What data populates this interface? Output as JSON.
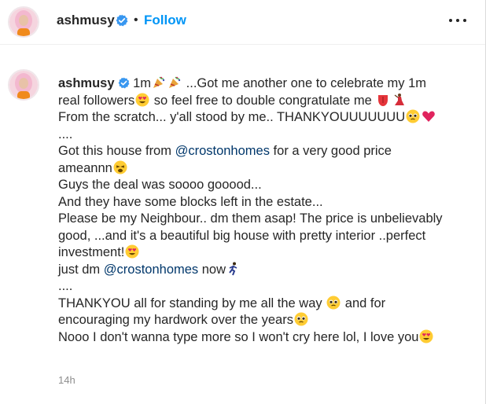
{
  "header": {
    "username": "ashmusy",
    "separator": "•",
    "follow_label": "Follow",
    "more_icon": "more-options-icon"
  },
  "caption": {
    "username": "ashmusy",
    "lines": [
      {
        "parts": [
          {
            "t": " 1m"
          },
          {
            "e": "party-popper"
          },
          {
            "e": "party-popper"
          },
          {
            "t": " ...Got me another one to celebrate my 1m"
          }
        ]
      },
      {
        "parts": [
          {
            "t": "real followers"
          },
          {
            "e": "heart-eyes"
          },
          {
            "t": " so feel free to double congratulate me "
          },
          {
            "e": "tongue"
          },
          {
            "e": "dancer"
          }
        ]
      },
      {
        "parts": [
          {
            "t": "From the scratch... y'all stood by me.. THANKYOUUUUUUU"
          },
          {
            "e": "pleading"
          },
          {
            "e": "red-heart"
          }
        ]
      },
      {
        "parts": [
          {
            "t": "...."
          }
        ]
      },
      {
        "parts": [
          {
            "t": "Got this house from "
          },
          {
            "m": "@crostonhomes"
          },
          {
            "t": " for a very good price"
          }
        ]
      },
      {
        "parts": [
          {
            "t": "ameannn"
          },
          {
            "e": "weary"
          }
        ]
      },
      {
        "parts": [
          {
            "t": "Guys the deal was soooo gooood..."
          }
        ]
      },
      {
        "parts": [
          {
            "t": "And they have some blocks left in the estate..."
          }
        ]
      },
      {
        "parts": [
          {
            "t": "Please be my Neighbour.. dm them asap! The price is unbelievably"
          }
        ]
      },
      {
        "parts": [
          {
            "t": "good, ...and it's a beautiful big house with pretty interior ..perfect"
          }
        ]
      },
      {
        "parts": [
          {
            "t": "investment!"
          },
          {
            "e": "heart-eyes"
          }
        ]
      },
      {
        "parts": [
          {
            "t": "just dm "
          },
          {
            "m": "@crostonhomes"
          },
          {
            "t": " now"
          },
          {
            "e": "running"
          }
        ]
      },
      {
        "parts": [
          {
            "t": "...."
          }
        ]
      },
      {
        "parts": [
          {
            "t": "THANKYOU all for standing by me all the way "
          },
          {
            "e": "pleading"
          },
          {
            "t": " and for"
          }
        ]
      },
      {
        "parts": [
          {
            "t": "encouraging my hardwork over the years"
          },
          {
            "e": "pleading"
          }
        ]
      },
      {
        "parts": [
          {
            "t": "Nooo I don't wanna type more so I won't cry here lol, I love you"
          },
          {
            "e": "heart-eyes"
          }
        ]
      }
    ],
    "timestamp": "14h"
  },
  "colors": {
    "follow_blue": "#0095f6",
    "mention_blue": "#00376b",
    "verified_blue": "#3897f0",
    "muted_gray": "#8e8e8e"
  }
}
